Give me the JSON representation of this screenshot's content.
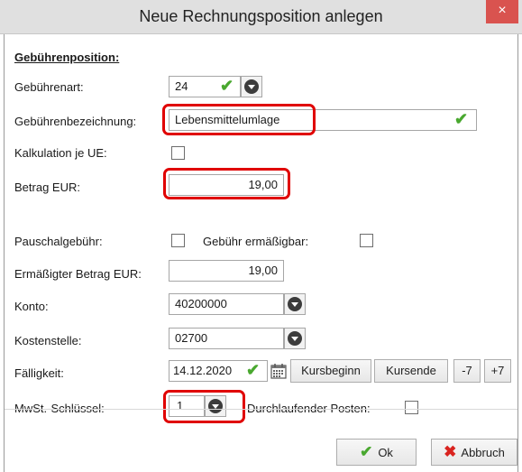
{
  "window": {
    "title": "Neue Rechnungsposition anlegen",
    "close_glyph": "×"
  },
  "section": {
    "title": "Gebührenposition:"
  },
  "labels": {
    "gebuehrenart": "Gebührenart:",
    "bezeichnung": "Gebührenbezeichnung:",
    "kalkulation": "Kalkulation je UE:",
    "betrag": "Betrag EUR:",
    "pauschal": "Pauschalgebühr:",
    "ermaessigbar": "Gebühr ermäßigbar:",
    "ermaessigter_betrag": "Ermäßigter Betrag EUR:",
    "konto": "Konto:",
    "kostenstelle": "Kostenstelle:",
    "faelligkeit": "Fälligkeit:",
    "mwst": "MwSt.-Schlüssel:",
    "durchlaufend": "Durchlaufender Posten:"
  },
  "values": {
    "gebuehrenart": "24",
    "bezeichnung": "Lebensmittelumlage",
    "betrag": "19,00",
    "ermaessigter_betrag": "19,00",
    "konto": "40200000",
    "kostenstelle": "02700",
    "faelligkeit": "14.12.2020",
    "mwst": "1"
  },
  "checkboxes": {
    "kalkulation": false,
    "pauschal": false,
    "ermaessigbar": false,
    "durchlaufend": false
  },
  "buttons": {
    "kursbeginn": "Kursbeginn",
    "kursende": "Kursende",
    "minus7": "-7",
    "plus7": "+7",
    "ok": "Ok",
    "abbruch": "Abbruch"
  },
  "icons": {
    "check": "✔",
    "abbruch": "✖"
  },
  "colors": {
    "highlight": "#e00000",
    "check": "#49a82f",
    "cancel": "#d9231f"
  }
}
